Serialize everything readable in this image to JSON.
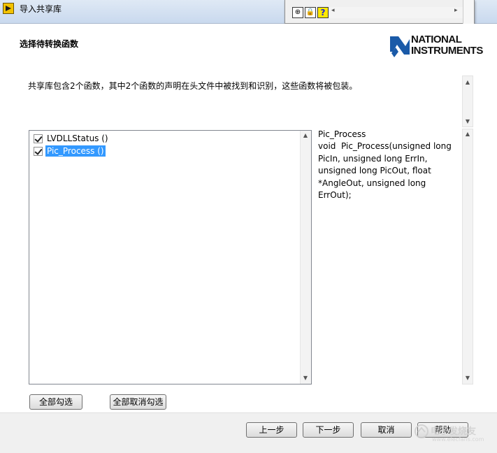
{
  "window": {
    "title": "导入共享库"
  },
  "toolbar": {
    "icons": [
      "probe-icon",
      "lock-icon",
      "help-icon"
    ]
  },
  "header": {
    "heading": "选择待转换函数",
    "logo_line1": "NATIONAL",
    "logo_line2": "INSTRUMENTS"
  },
  "description": "共享库包含2个函数，其中2个函数的声明在头文件中被找到和识别，这些函数将被包装。",
  "functions": [
    {
      "label": "LVDLLStatus ()",
      "checked": true,
      "selected": false
    },
    {
      "label": "Pic_Process ()",
      "checked": true,
      "selected": true
    }
  ],
  "prototype": {
    "name": "Pic_Process",
    "signature": "void  Pic_Process(unsigned long PicIn, unsigned long ErrIn, unsigned long PicOut, float *AngleOut, unsigned long ErrOut);"
  },
  "buttons": {
    "select_all": "全部勾选",
    "deselect_all": "全部取消勾选",
    "back": "上一步",
    "next": "下一步",
    "cancel": "取消",
    "help": "帮助"
  },
  "watermark": {
    "text": "电子发烧友",
    "url": "www.elecfans.com"
  },
  "colors": {
    "selection": "#3399ff",
    "titlebar": "#d5e3f3",
    "help_icon": "#ffe900"
  }
}
